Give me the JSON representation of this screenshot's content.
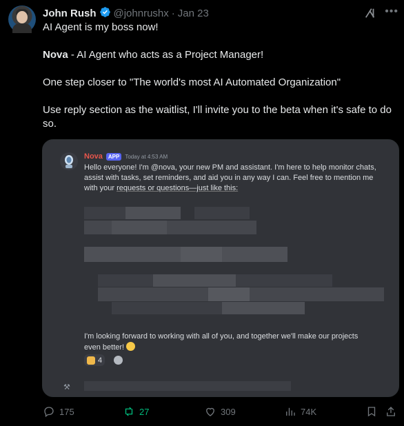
{
  "tweet": {
    "author_name": "John Rush",
    "handle": "@johnrushx",
    "separator": "·",
    "date": "Jan 23",
    "line1": "AI Agent is my boss now!",
    "line2_bold": "Nova",
    "line2_rest": " - AI Agent who acts as a Project Manager!",
    "line3": "One step closer to \"The world's most AI Automated Organization\"",
    "line4": "Use reply section as the waitlist, I'll invite you to the beta when it's safe to do so."
  },
  "media": {
    "bot_name": "Nova",
    "badge": "APP",
    "time": "Today at 4:53 AM",
    "message_intro": "Hello everyone! I'm @nova, your new PM and assistant. I'm here to help monitor chats, assist with tasks, set reminders, and aid you in any way I can. Feel free to mention me with your",
    "message_link": "requests or questions—just like this:",
    "closing": "I'm looking forward to working with all of you, and together we'll make our projects even better!",
    "reaction_count": "4"
  },
  "actions": {
    "replies": "175",
    "retweets": "27",
    "likes": "309",
    "views": "74K"
  },
  "colors": {
    "accent_blue": "#1d9bf0",
    "retweet_green": "#00ba7c",
    "muted": "#71767b",
    "bot_name": "#e8564c"
  },
  "icons": [
    "verified-icon",
    "grok-icon",
    "more-icon",
    "reply-icon",
    "retweet-icon",
    "like-icon",
    "views-icon",
    "bookmark-icon",
    "share-icon"
  ]
}
